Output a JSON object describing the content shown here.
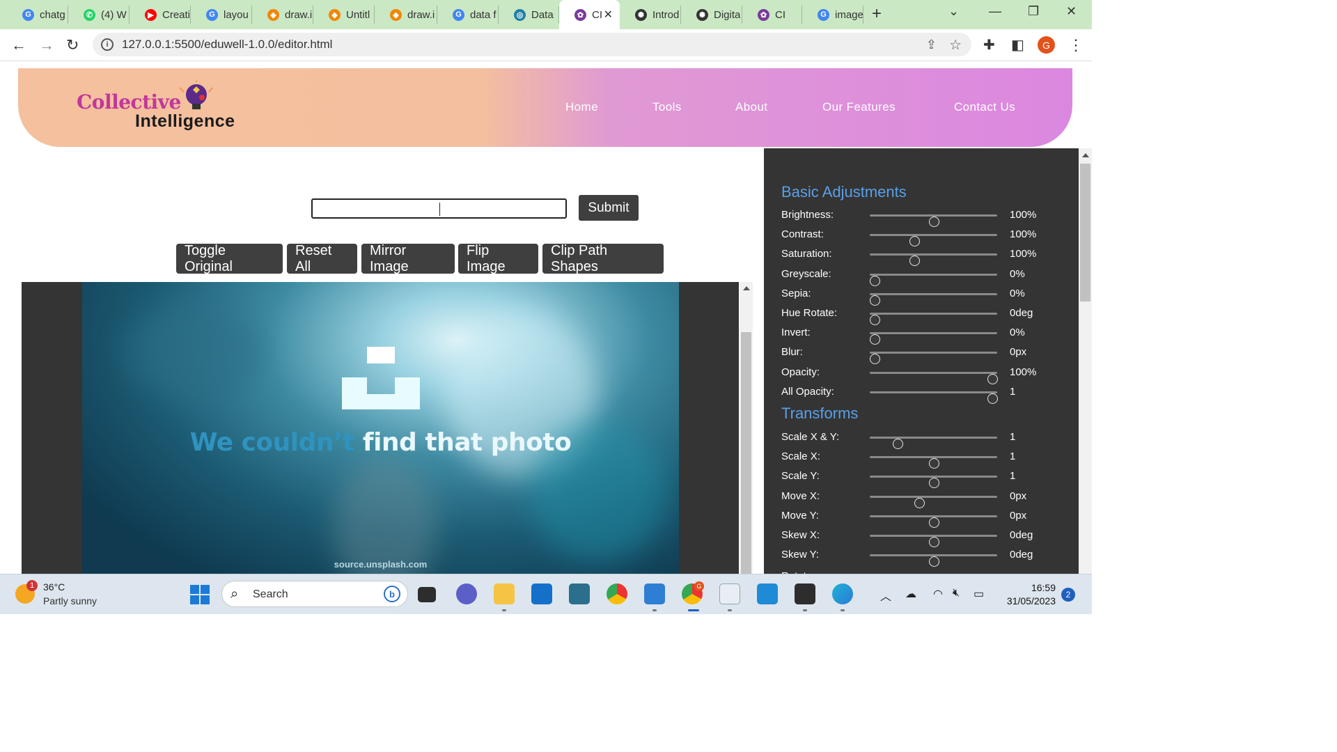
{
  "browser": {
    "tabs": [
      {
        "label": "chatg",
        "icon": "google-icon"
      },
      {
        "label": "(4) W",
        "icon": "whatsapp-icon"
      },
      {
        "label": "Creati",
        "icon": "youtube-icon"
      },
      {
        "label": "layou",
        "icon": "google-icon"
      },
      {
        "label": "draw.i",
        "icon": "drawio-icon"
      },
      {
        "label": "Untitl",
        "icon": "drawio-icon"
      },
      {
        "label": "draw.i",
        "icon": "drawio-icon"
      },
      {
        "label": "data f",
        "icon": "google-icon"
      },
      {
        "label": "Data",
        "icon": "globe-icon"
      },
      {
        "label": "CI",
        "icon": "ci-logo-icon",
        "active": true
      },
      {
        "label": "Introd",
        "icon": "openai-icon"
      },
      {
        "label": "Digita",
        "icon": "openai-icon"
      },
      {
        "label": "CI",
        "icon": "ci-logo-icon"
      },
      {
        "label": "image",
        "icon": "google-icon"
      }
    ],
    "url": "127.0.0.1:5500/eduwell-1.0.0/editor.html",
    "profile_initial": "G"
  },
  "site": {
    "logo_line1": "Collective",
    "logo_line2": "Intelligence",
    "nav": [
      "Home",
      "Tools",
      "About",
      "Our Features",
      "Contact Us"
    ]
  },
  "editor": {
    "search_value": "",
    "submit_label": "Submit",
    "buttons": [
      "Toggle Original",
      "Reset All",
      "Mirror Image",
      "Flip Image",
      "Clip Path Shapes"
    ],
    "photo": {
      "message_part1": "We couldn’t ",
      "message_part2": "find that photo",
      "source": "source.unsplash.com"
    }
  },
  "panel": {
    "basic_title": "Basic Adjustments",
    "basic": [
      {
        "label": "Brightness:",
        "value": "100%",
        "level": 0.5
      },
      {
        "label": "Contrast:",
        "value": "100%",
        "level": 0.35
      },
      {
        "label": "Saturation:",
        "value": "100%",
        "level": 0.35
      },
      {
        "label": "Greyscale:",
        "value": "0%",
        "level": 0.04
      },
      {
        "label": "Sepia:",
        "value": "0%",
        "level": 0.04
      },
      {
        "label": "Hue Rotate:",
        "value": "0deg",
        "level": 0.04
      },
      {
        "label": "Invert:",
        "value": "0%",
        "level": 0.04
      },
      {
        "label": "Blur:",
        "value": "0px",
        "level": 0.04
      },
      {
        "label": "Opacity:",
        "value": "100%",
        "level": 0.96
      },
      {
        "label": "All Opacity:",
        "value": "1",
        "level": 0.96
      }
    ],
    "transforms_title": "Transforms",
    "transforms": [
      {
        "label": "Scale X & Y:",
        "value": "1",
        "level": 0.22
      },
      {
        "label": "Scale X:",
        "value": "1",
        "level": 0.5
      },
      {
        "label": "Scale Y:",
        "value": "1",
        "level": 0.5
      },
      {
        "label": "Move X:",
        "value": "0px",
        "level": 0.39
      },
      {
        "label": "Move Y:",
        "value": "0px",
        "level": 0.5
      },
      {
        "label": "Skew X:",
        "value": "0deg",
        "level": 0.5
      },
      {
        "label": "Skew Y:",
        "value": "0deg",
        "level": 0.5
      }
    ]
  },
  "taskbar": {
    "weather_temp": "36°C",
    "weather_cond": "Partly sunny",
    "weather_badge": "1",
    "search_label": "Search",
    "time": "16:59",
    "date": "31/05/2023",
    "notifications": "2",
    "chrome_badge": "G"
  },
  "colors": {
    "header_left": "#f4c09d",
    "header_right": "#db87e0",
    "panel_bg": "#343434",
    "section_title": "#5aa0e6",
    "button_bg": "#3f3f3f"
  }
}
